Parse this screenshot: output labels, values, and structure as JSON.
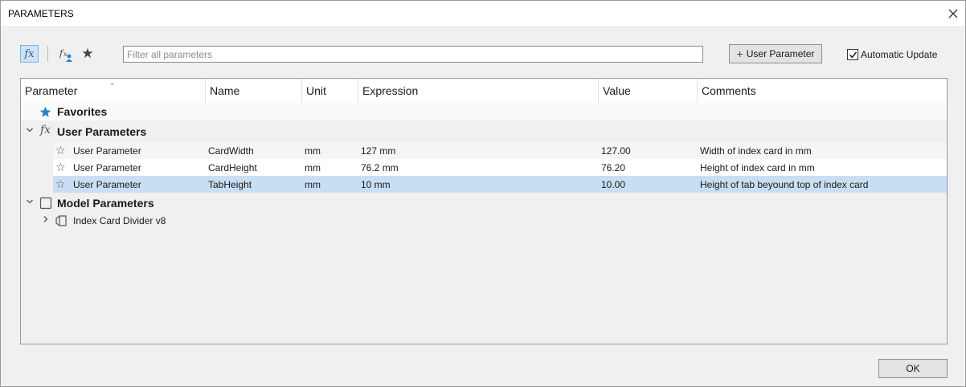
{
  "window": {
    "title": "PARAMETERS",
    "close_icon": "close-icon"
  },
  "toolbar": {
    "fx_label": "fx",
    "fx_user_label": "fx",
    "filter_placeholder": "Filter all parameters",
    "filter_value": "",
    "user_parameter_label": "User Parameter",
    "automatic_update_label": "Automatic Update",
    "automatic_update_checked": true
  },
  "table": {
    "headers": {
      "parameter": "Parameter",
      "name": "Name",
      "unit": "Unit",
      "expression": "Expression",
      "value": "Value",
      "comments": "Comments"
    },
    "groups": {
      "favorites": "Favorites",
      "user_parameters": "User Parameters",
      "model_parameters": "Model Parameters"
    },
    "user_rows": [
      {
        "parameter": "User Parameter",
        "name": "CardWidth",
        "unit": "mm",
        "expression": "127 mm",
        "value": "127.00",
        "comments": "Width of index card in mm"
      },
      {
        "parameter": "User Parameter",
        "name": "CardHeight",
        "unit": "mm",
        "expression": "76.2 mm",
        "value": "76.20",
        "comments": "Height of index card in mm"
      },
      {
        "parameter": "User Parameter",
        "name": "TabHeight",
        "unit": "mm",
        "expression": "10 mm",
        "value": "10.00",
        "comments": "Height of tab beyound top of index card"
      }
    ],
    "selected_row": 2,
    "model_children": [
      {
        "label": "Index Card Divider v8"
      }
    ]
  },
  "footer": {
    "ok_label": "OK"
  },
  "colors": {
    "accent": "#1e88d0",
    "selection": "#c8dff3"
  }
}
